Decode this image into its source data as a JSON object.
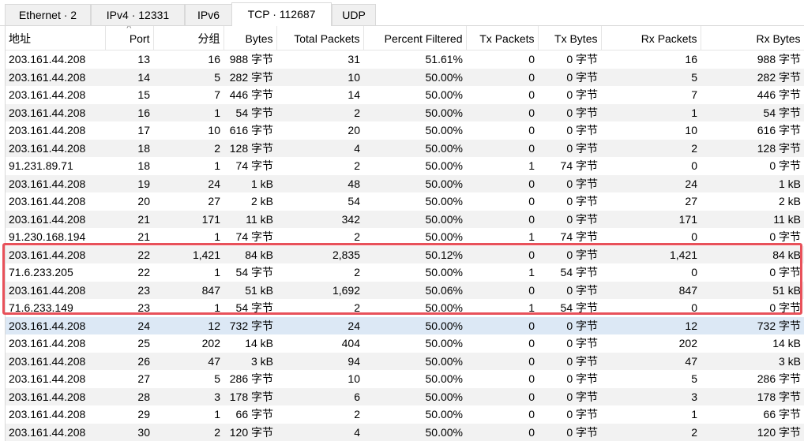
{
  "tabs": [
    {
      "label": "Ethernet · 2",
      "active": false
    },
    {
      "label": "IPv4 · 12331",
      "active": false
    },
    {
      "label": "IPv6",
      "active": false
    },
    {
      "label": "TCP · 112687",
      "active": true
    },
    {
      "label": "UDP",
      "active": false
    }
  ],
  "columns": [
    "地址",
    "Port",
    "分组",
    "Bytes",
    "Total Packets",
    "Percent Filtered",
    "Tx Packets",
    "Tx Bytes",
    "Rx Packets",
    "Rx Bytes"
  ],
  "sort_indicator": "^",
  "sorted_column": "Port",
  "rows": [
    [
      "203.161.44.208",
      "13",
      "16",
      "988 字节",
      "31",
      "51.61%",
      "0",
      "0 字节",
      "16",
      "988 字节"
    ],
    [
      "203.161.44.208",
      "14",
      "5",
      "282 字节",
      "10",
      "50.00%",
      "0",
      "0 字节",
      "5",
      "282 字节"
    ],
    [
      "203.161.44.208",
      "15",
      "7",
      "446 字节",
      "14",
      "50.00%",
      "0",
      "0 字节",
      "7",
      "446 字节"
    ],
    [
      "203.161.44.208",
      "16",
      "1",
      "54 字节",
      "2",
      "50.00%",
      "0",
      "0 字节",
      "1",
      "54 字节"
    ],
    [
      "203.161.44.208",
      "17",
      "10",
      "616 字节",
      "20",
      "50.00%",
      "0",
      "0 字节",
      "10",
      "616 字节"
    ],
    [
      "203.161.44.208",
      "18",
      "2",
      "128 字节",
      "4",
      "50.00%",
      "0",
      "0 字节",
      "2",
      "128 字节"
    ],
    [
      "91.231.89.71",
      "18",
      "1",
      "74 字节",
      "2",
      "50.00%",
      "1",
      "74 字节",
      "0",
      "0 字节"
    ],
    [
      "203.161.44.208",
      "19",
      "24",
      "1 kB",
      "48",
      "50.00%",
      "0",
      "0 字节",
      "24",
      "1 kB"
    ],
    [
      "203.161.44.208",
      "20",
      "27",
      "2 kB",
      "54",
      "50.00%",
      "0",
      "0 字节",
      "27",
      "2 kB"
    ],
    [
      "203.161.44.208",
      "21",
      "171",
      "11 kB",
      "342",
      "50.00%",
      "0",
      "0 字节",
      "171",
      "11 kB"
    ],
    [
      "91.230.168.194",
      "21",
      "1",
      "74 字节",
      "2",
      "50.00%",
      "1",
      "74 字节",
      "0",
      "0 字节"
    ],
    [
      "203.161.44.208",
      "22",
      "1,421",
      "84 kB",
      "2,835",
      "50.12%",
      "0",
      "0 字节",
      "1,421",
      "84 kB"
    ],
    [
      "71.6.233.205",
      "22",
      "1",
      "54 字节",
      "2",
      "50.00%",
      "1",
      "54 字节",
      "0",
      "0 字节"
    ],
    [
      "203.161.44.208",
      "23",
      "847",
      "51 kB",
      "1,692",
      "50.06%",
      "0",
      "0 字节",
      "847",
      "51 kB"
    ],
    [
      "71.6.233.149",
      "23",
      "1",
      "54 字节",
      "2",
      "50.00%",
      "1",
      "54 字节",
      "0",
      "0 字节"
    ],
    [
      "203.161.44.208",
      "24",
      "12",
      "732 字节",
      "24",
      "50.00%",
      "0",
      "0 字节",
      "12",
      "732 字节"
    ],
    [
      "203.161.44.208",
      "25",
      "202",
      "14 kB",
      "404",
      "50.00%",
      "0",
      "0 字节",
      "202",
      "14 kB"
    ],
    [
      "203.161.44.208",
      "26",
      "47",
      "3 kB",
      "94",
      "50.00%",
      "0",
      "0 字节",
      "47",
      "3 kB"
    ],
    [
      "203.161.44.208",
      "27",
      "5",
      "286 字节",
      "10",
      "50.00%",
      "0",
      "0 字节",
      "5",
      "286 字节"
    ],
    [
      "203.161.44.208",
      "28",
      "3",
      "178 字节",
      "6",
      "50.00%",
      "0",
      "0 字节",
      "3",
      "178 字节"
    ],
    [
      "203.161.44.208",
      "29",
      "1",
      "66 字节",
      "2",
      "50.00%",
      "0",
      "0 字节",
      "1",
      "66 字节"
    ],
    [
      "203.161.44.208",
      "30",
      "2",
      "120 字节",
      "4",
      "50.00%",
      "0",
      "0 字节",
      "2",
      "120 字节"
    ]
  ],
  "selected_row_index": 15,
  "highlight_rows": [
    11,
    12,
    13,
    14
  ],
  "colors": {
    "highlight_border": "#e8515a",
    "selected_row": "#dce8f5",
    "alt_row": "#f2f2f2",
    "tab_inactive": "#f0f0f0"
  }
}
